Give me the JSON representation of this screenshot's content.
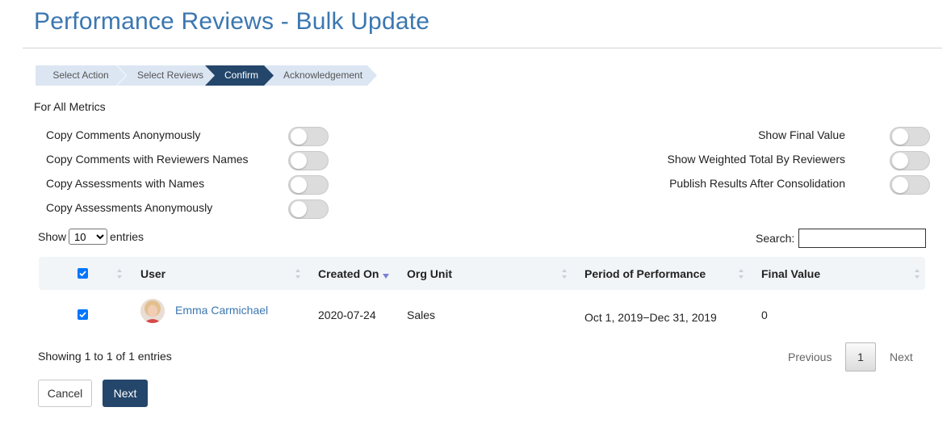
{
  "page": {
    "title": "Performance Reviews - Bulk Update"
  },
  "wizard": {
    "steps": [
      {
        "label": "Select Action",
        "state": "done"
      },
      {
        "label": "Select Reviews",
        "state": "done"
      },
      {
        "label": "Confirm",
        "state": "active"
      },
      {
        "label": "Acknowledgement",
        "state": "pending"
      }
    ]
  },
  "section_label": "For All Metrics",
  "options": {
    "left": [
      {
        "label": "Copy Comments Anonymously",
        "on": false
      },
      {
        "label": "Copy Comments with Reviewers Names",
        "on": false
      },
      {
        "label": "Copy Assessments with Names",
        "on": false
      },
      {
        "label": "Copy Assessments Anonymously",
        "on": false
      }
    ],
    "right": [
      {
        "label": "Show Final Value",
        "on": false
      },
      {
        "label": "Show Weighted Total By Reviewers",
        "on": false
      },
      {
        "label": "Publish Results After Consolidation",
        "on": false
      }
    ]
  },
  "table_controls": {
    "show_label": "Show",
    "page_size": "10",
    "entries_label": "entries",
    "search_label": "Search:",
    "search_value": ""
  },
  "table": {
    "columns": [
      "User",
      "Created On",
      "Org Unit",
      "Period of Performance",
      "Final Value"
    ],
    "rows": [
      {
        "checked": true,
        "user": "Emma Carmichael",
        "created_on": "2020-07-24",
        "org_unit": "Sales",
        "period": "Oct 1, 2019−Dec 31, 2019",
        "final_value": "0"
      }
    ]
  },
  "pagination": {
    "info": "Showing 1 to 1 of 1 entries",
    "previous": "Previous",
    "current": "1",
    "next": "Next"
  },
  "buttons": {
    "cancel": "Cancel",
    "next": "Next"
  },
  "colors": {
    "title": "#3b77b0",
    "active_step": "#24466b",
    "step": "#dce6f3",
    "checkbox": "#0075ff"
  }
}
